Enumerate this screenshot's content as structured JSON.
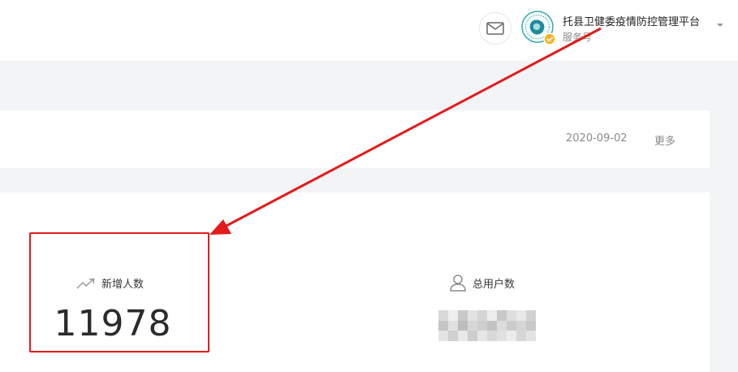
{
  "header": {
    "mail_icon": "mail-icon",
    "account": {
      "name": "托县卫健委疫情防控管理平台",
      "type": "服务号",
      "avatar_icon": "account-logo-icon",
      "verified_icon": "verified-badge-icon",
      "dropdown_icon": "caret-down-icon"
    }
  },
  "notice": {
    "date": "2020-09-02",
    "more_label": "更多"
  },
  "stats": {
    "new_users": {
      "icon": "trend-up-icon",
      "label": "新增人数",
      "value": "11978"
    },
    "total_users": {
      "icon": "user-icon",
      "label": "总用户数"
    }
  },
  "annotation": {
    "color": "#e31b1b"
  },
  "colors": {
    "background": "#f3f4f6",
    "card": "#ffffff",
    "muted_text": "#8a8a8a"
  }
}
